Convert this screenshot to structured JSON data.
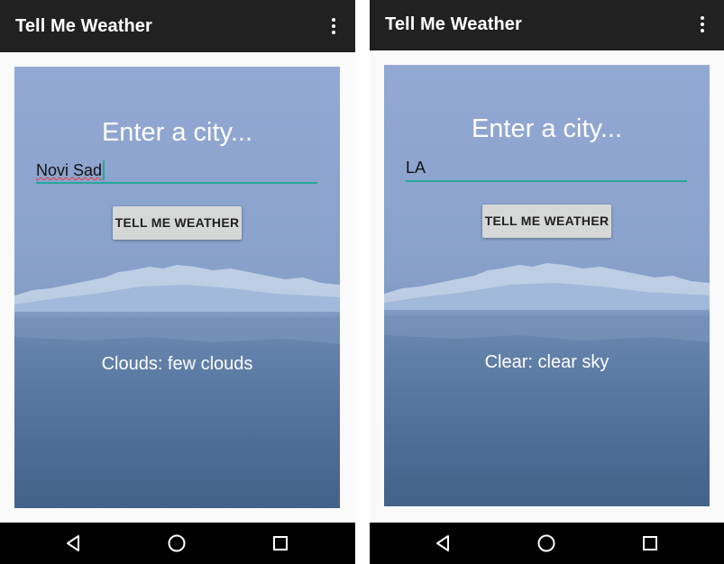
{
  "screens": [
    {
      "app_title": "Tell Me Weather",
      "heading": "Enter a city...",
      "city_input_value": "Novi Sad",
      "button_label": "TELL ME WEATHER",
      "weather_result": "Clouds: few clouds"
    },
    {
      "app_title": "Tell Me Weather",
      "heading": "Enter a city...",
      "city_input_value": "LA",
      "button_label": "TELL ME WEATHER",
      "weather_result": "Clear: clear sky"
    }
  ],
  "nav_icons": [
    "back-icon",
    "home-icon",
    "recents-icon"
  ],
  "colors": {
    "app_bar": "#212121",
    "accent": "#26a69a",
    "button_bg": "#d6d7d7",
    "nav_bar": "#000000"
  }
}
